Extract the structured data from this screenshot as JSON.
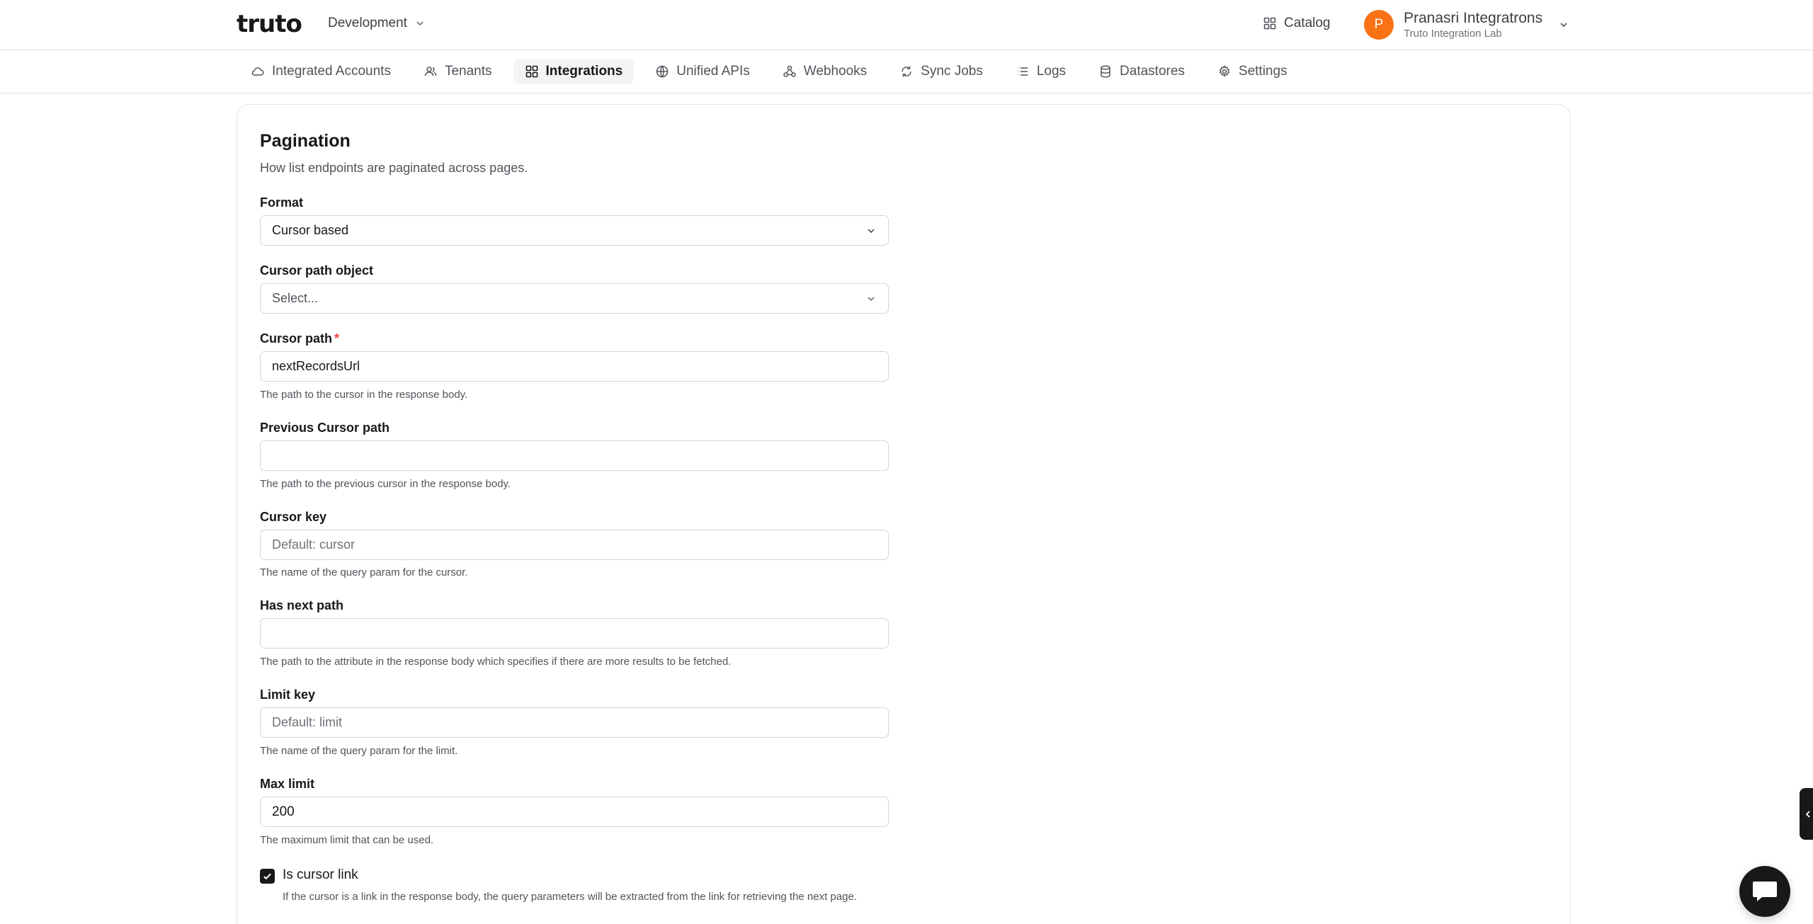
{
  "header": {
    "logo_text": "truto",
    "environment": "Development",
    "catalog_label": "Catalog",
    "user": {
      "initial": "P",
      "name": "Pranasri Integratrons",
      "org": "Truto Integration Lab"
    }
  },
  "nav": {
    "tabs": [
      {
        "label": "Integrated Accounts",
        "icon": "cloud-icon"
      },
      {
        "label": "Tenants",
        "icon": "users-icon"
      },
      {
        "label": "Integrations",
        "icon": "grid-icon",
        "active": true
      },
      {
        "label": "Unified APIs",
        "icon": "globe-icon"
      },
      {
        "label": "Webhooks",
        "icon": "webhook-icon"
      },
      {
        "label": "Sync Jobs",
        "icon": "sync-icon"
      },
      {
        "label": "Logs",
        "icon": "list-icon"
      },
      {
        "label": "Datastores",
        "icon": "database-icon"
      },
      {
        "label": "Settings",
        "icon": "gear-icon"
      }
    ]
  },
  "pagination": {
    "title": "Pagination",
    "description": "How list endpoints are paginated across pages.",
    "format": {
      "label": "Format",
      "value": "Cursor based"
    },
    "cursor_path_object": {
      "label": "Cursor path object",
      "placeholder": "Select..."
    },
    "cursor_path": {
      "label": "Cursor path",
      "required": "*",
      "value": "nextRecordsUrl",
      "hint": "The path to the cursor in the response body."
    },
    "previous_cursor_path": {
      "label": "Previous Cursor path",
      "value": "",
      "hint": "The path to the previous cursor in the response body."
    },
    "cursor_key": {
      "label": "Cursor key",
      "placeholder": "Default: cursor",
      "hint": "The name of the query param for the cursor."
    },
    "has_next_path": {
      "label": "Has next path",
      "value": "",
      "hint": "The path to the attribute in the response body which specifies if there are more results to be fetched."
    },
    "limit_key": {
      "label": "Limit key",
      "placeholder": "Default: limit",
      "hint": "The name of the query param for the limit."
    },
    "max_limit": {
      "label": "Max limit",
      "value": "200",
      "hint": "The maximum limit that can be used."
    },
    "is_cursor_link": {
      "label": "Is cursor link",
      "checked": true,
      "hint": "If the cursor is a link in the response body, the query parameters will be extracted from the link for retrieving the next page."
    }
  },
  "colors": {
    "accent": "#18181b",
    "avatar": "#f97316",
    "required": "#ef4444"
  }
}
